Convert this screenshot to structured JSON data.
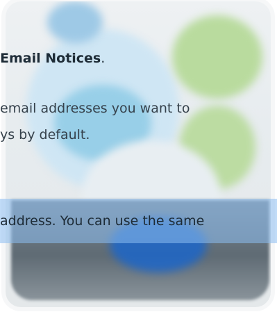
{
  "heading": {
    "bold": "Email Notices",
    "suffix": "."
  },
  "paragraph": {
    "line1": "email addresses you want to",
    "line2": "ys by default."
  },
  "highlight": {
    "text": "address. You can use the same"
  }
}
